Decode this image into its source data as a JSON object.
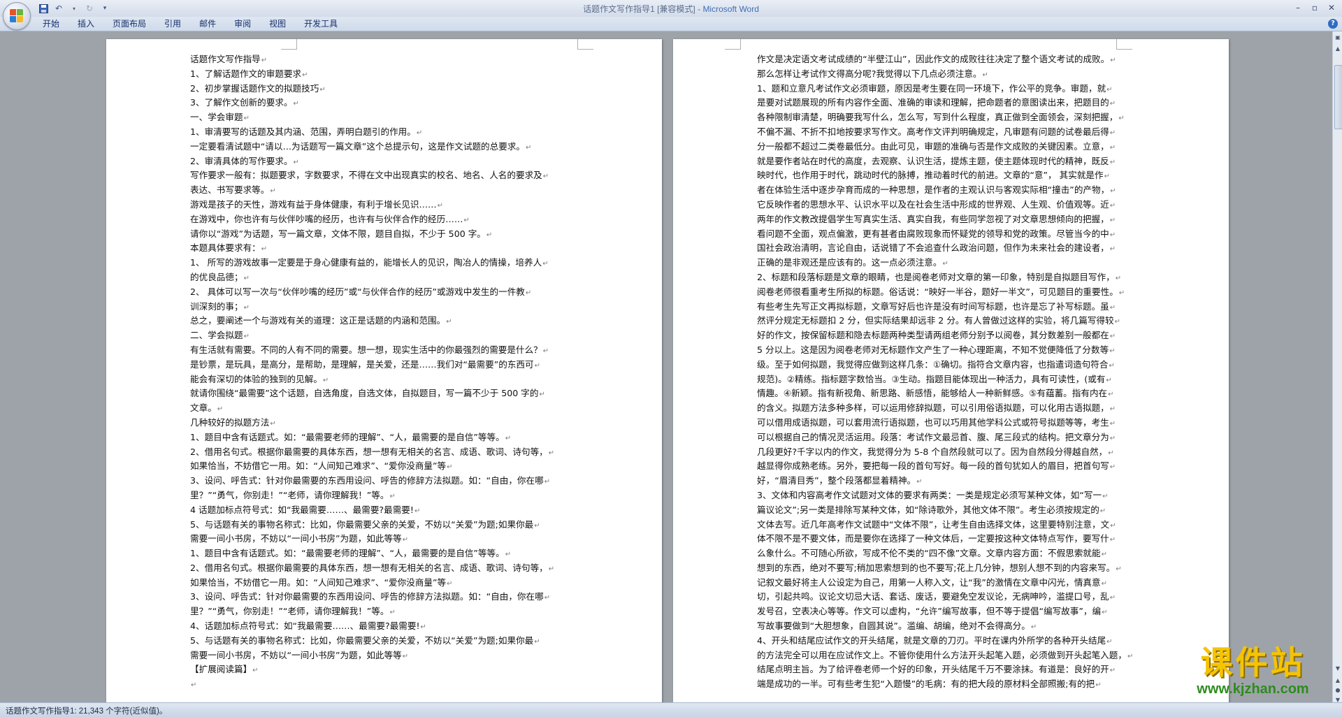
{
  "window": {
    "title_doc": "话题作文写作指导1 [兼容模式] - ",
    "title_brand": "Microsoft Word"
  },
  "qat": {
    "icons": [
      "save-icon",
      "undo-icon",
      "redo-icon",
      "customize-icon"
    ]
  },
  "ribbon": {
    "tabs": [
      "开始",
      "插入",
      "页面布局",
      "引用",
      "邮件",
      "审阅",
      "视图",
      "开发工具"
    ]
  },
  "doc": {
    "left_lines": [
      "话题作文写作指导",
      "1、了解话题作文的审题要求",
      "2、初步掌握话题作文的拟题技巧",
      "3、了解作文创新的要求。",
      "一、学会审题",
      "1、审清要写的话题及其内涵、范围，弄明白题引的作用。",
      "一定要看清试题中“请以…为话题写一篇文章”这个总提示句，这是作文试题的总要求。",
      "2、审清具体的写作要求。",
      "写作要求一般有：拟题要求，字数要求，不得在文中出现真实的校名、地名、人名的要求及",
      "表达、书写要求等。",
      "游戏是孩子的天性，游戏有益于身体健康，有利于增长见识……",
      "在游戏中，你也许有与伙伴吵嘴的经历，也许有与伙伴合作的经历……",
      "请你以“游戏”为话题，写一篇文章，文体不限，题目自拟，不少于 500 字。",
      "本题具体要求有：",
      "1、 所写的游戏故事一定要是于身心健康有益的，能增长人的见识，陶冶人的情操，培养人",
      "的优良品德；",
      "2、 具体可以写一次与“伙伴吵嘴的经历”或“与伙伴合作的经历”或游戏中发生的一件教",
      "训深刻的事；",
      "总之，要阐述一个与游戏有关的道理：这正是话题的内涵和范围。",
      "二、学会拟题",
      "有生活就有需要。不同的人有不同的需要。想一想，现实生活中的你最强烈的需要是什么？",
      "是钞票，是玩具，是高分，是帮助，是理解，是关爱，还是……我们对“最需要”的东西可",
      "能会有深切的体验的独到的见解。",
      "就请你围绕“最需要”这个话题，自选角度，自选文体，自拟题目，写一篇不少于 500 字的",
      "文章。",
      "几种较好的拟题方法",
      "1、题目中含有话题式。如：“最需要老师的理解”、“人，最需要的是自信”等等。",
      "2、借用名句式。根据你最需要的具体东西，想一想有无相关的名言、成语、歌词、诗句等，",
      "如果恰当，不妨借它一用。如：“人间知己难求”、“爱你没商量”等",
      "3、设问、呼告式：针对你最需要的东西用设问、呼告的修辞方法拟题。如：“自由，你在哪",
      "里？”“勇气，你别走！”“老师，请你理解我！”等。",
      "4 话题加标点符号式：如“我最需要……、最需要?最需要!",
      "5、与话题有关的事物名称式：比如，你最需要父亲的关爱，不妨以“关爱”为题;如果你最",
      "需要一间小书房，不妨以“一间小书房”为题，如此等等",
      "1、题目中含有话题式。如：“最需要老师的理解”、“人，最需要的是自信”等等。",
      "2、借用名句式。根据你最需要的具体东西，想一想有无相关的名言、成语、歌词、诗句等，",
      "如果恰当，不妨借它一用。如：“人间知己难求”、“爱你没商量”等",
      "3、设问、呼告式：针对你最需要的东西用设问、呼告的修辞方法拟题。如：“自由，你在哪",
      "里？”“勇气，你别走！”“老师，请你理解我！”等。",
      "4、话题加标点符号式：如“我最需要……、最需要?最需要!",
      "5、与话题有关的事物名称式：比如，你最需要父亲的关爱，不妨以“关爱”为题;如果你最",
      "需要一间小书房，不妨以“一间小书房”为题，如此等等",
      "【扩展阅读篇】",
      ""
    ],
    "right_lines": [
      "作文是决定语文考试成绩的“半壁江山”，因此作文的成败往往决定了整个语文考试的成败。",
      "那么怎样让考试作文得高分呢?我觉得以下几点必须注意。",
      "1、题和立意凡考试作文必须审题，原因是考生要在同一环境下，作公平的竞争。审题，就",
      "是要对试题展现的所有内容作全面、准确的审读和理解，把命题者的意图读出来，把题目的",
      "各种限制审清楚，明确要我写什么，怎么写，写到什么程度，真正做到全面领会，深刻把握，",
      "不偏不漏、不折不扣地按要求写作文。高考作文评判明确规定，凡审题有问题的试卷最后得",
      "分一般都不超过二类卷最低分。由此可见，审题的准确与否是作文成败的关键因素。立意，",
      "就是要作者站在时代的高度，去观察、认识生活，提炼主题，使主题体现时代的精神，既反",
      "映时代，也作用于时代，跳动时代的脉搏，推动着时代的前进。文章的“意”， 其实就是作",
      "者在体验生活中逐步孕育而成的一种思想，是作者的主观认识与客观实际相“撞击”的产物，",
      "它反映作者的思想水平、认识水平以及在社会生活中形成的世界观、人生观、价值观等。近",
      "两年的作文教改提倡学生写真实生活、真实自我，有些同学忽视了对文章思想倾向的把握，",
      "看问题不全面，观点偏激，更有甚者由腐败现象而怀疑党的领导和党的政策。尽管当今的中",
      "国社会政治清明，言论自由，话说错了不会追查什么政治问题，但作为未来社会的建设者，",
      "正确的是非观还是应该有的。这一点必须注意。",
      "2、标题和段落标题是文章的眼睛，也是阅卷老师对文章的第一印象，特别是自拟题目写作，",
      "阅卷老师很看重考生所拟的标题。俗话说：“映好一半谷，题好一半文”，可见题目的重要性。",
      "有些考生先写正文再拟标题，文章写好后也许是没有时间写标题，也许是忘了补写标题。虽",
      "然评分规定无标题扣 2 分，但实际结果却远非 2 分。有人曾做过这样的实验，将几篇写得较",
      "好的作文，按保留标题和隐去标题两种类型请两组老师分别予以阅卷，其分数差别一般都在",
      "5 分以上。这是因为阅卷老师对无标题作文产生了一种心理距离，不知不觉便降低了分数等",
      "级。至于如何拟题，我觉得应做到这样几条：①确切。指符合文章内容，也指遣词造句符合",
      "规范)。②精练。指标题字数恰当。③生动。指题目能体现出一种活力，具有可读性，(或有",
      "情趣。④新颖。指有新视角、新思路、新感悟，能够给人一种新鲜感。⑤有蕴蓄。指有内在",
      "的含义。拟题方法多种多样，可以运用修辞拟题，可以引用俗语拟题，可以化用古语拟题，",
      "可以借用成语拟题，可以套用流行语拟题，也可以巧用其他学科公式或符号拟题等等，考生",
      "可以根据自己的情况灵活运用。段落：考试作文最忌首、腹、尾三段式的结构。把文章分为",
      "几段更好?千字以内的作文，我觉得分为 5-8 个自然段就可以了。因为自然段分得越自然，",
      "越显得你成熟老练。另外，要把每一段的首句写好。每一段的首句犹如人的眉目，把首句写",
      "好，“眉清目秀”，整个段落都显着精神。",
      "3、文体和内容高考作文试题对文体的要求有两类：一类是规定必须写某种文体，如“写一",
      "篇议论文”;另一类是排除写某种文体，如“除诗歌外，其他文体不限”。考生必须按规定的",
      "文体去写。近几年高考作文试题中“文体不限”，让考生自由选择文体，这里要特别注意，文",
      "体不限不是不要文体，而是要你在选择了一种文体后，一定要按这种文体特点写作，要写什",
      "么象什么。不可随心所欲，写成不伦不类的“四不像”文章。文章内容方面：不假思索就能",
      "想到的东西，绝对不要写;稍加思索想到的也不要写;花上几分钟，想别人想不到的内容来写。",
      "记叙文最好将主人公设定为自己，用第一人称入文，让“我”的激情在文章中闪光，情真意",
      "切，引起共鸣。议论文切忌大话、套话、废话，要避免空发议论，无病呻吟，滥提口号，乱",
      "发号召，空表决心等等。作文可以虚构，“允许”编写故事，但不等于提倡“编写故事”，编",
      "写故事要做到“大胆想象，自圆其说”。滥编、胡编，绝对不会得高分。",
      "4、开头和结尾应试作文的开头结尾，就是文章的刀刃。平时在课内外所学的各种开头结尾",
      "的方法完全可以用在应试作文上。不管你使用什么方法开头起笔入题，必须做到开头起笔入题，",
      "结尾点明主旨。为了给评卷老师一个好的印象，开头结尾千万不要涂抹。有道是：良好的开",
      "端是成功的一半。可有些考生犯“入题慢”的毛病：有的把大段的原材料全部照搬;有的把"
    ]
  },
  "status": {
    "text": "话题作文写作指导1: 21,343 个字符(近似值)。"
  },
  "watermark": {
    "title": "课件站",
    "url": "www.kjzhan.com"
  }
}
